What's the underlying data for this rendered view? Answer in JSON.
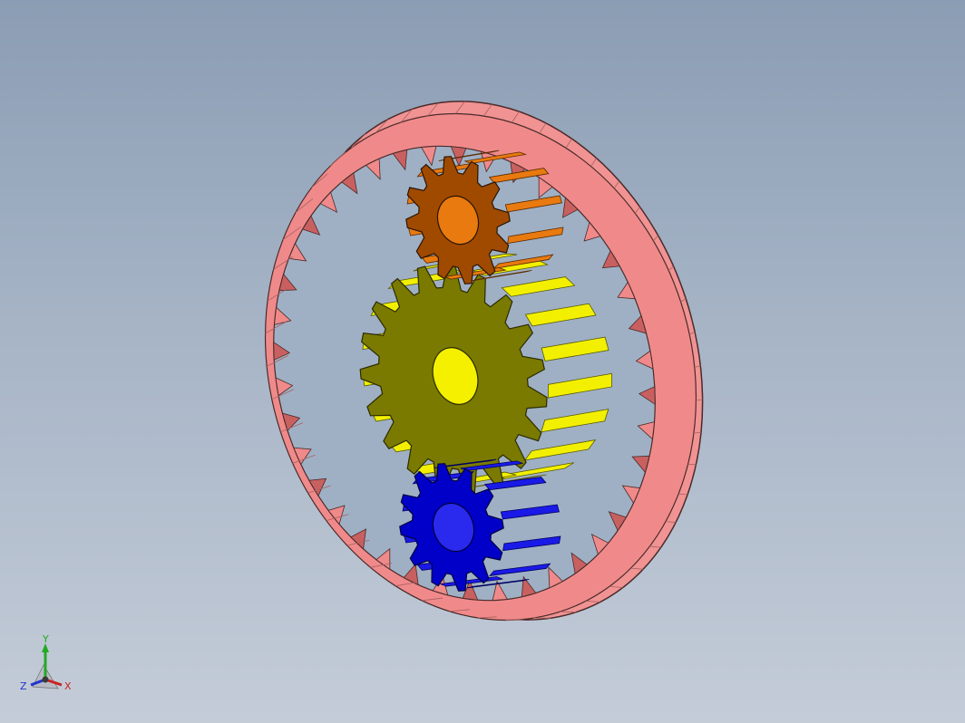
{
  "viewport": {
    "background_top": "#8b9db4",
    "background_bottom": "#c4ccd8"
  },
  "model": {
    "parts": [
      {
        "name": "ring-gear",
        "color": "#f08a8a",
        "shade": "#c96060"
      },
      {
        "name": "sun-gear",
        "color": "#7a7a00",
        "side": "#f2f000"
      },
      {
        "name": "upper-planet-gear",
        "color": "#a04a00",
        "side": "#e87a10"
      },
      {
        "name": "lower-planet-gear",
        "color": "#0000c8",
        "side": "#1a1ae8"
      }
    ]
  },
  "triad": {
    "y_label": "Y",
    "z_label": "Z",
    "x_label": "X",
    "y_color": "#22aa22",
    "z_color": "#2233cc",
    "x_color": "#cc2222"
  }
}
